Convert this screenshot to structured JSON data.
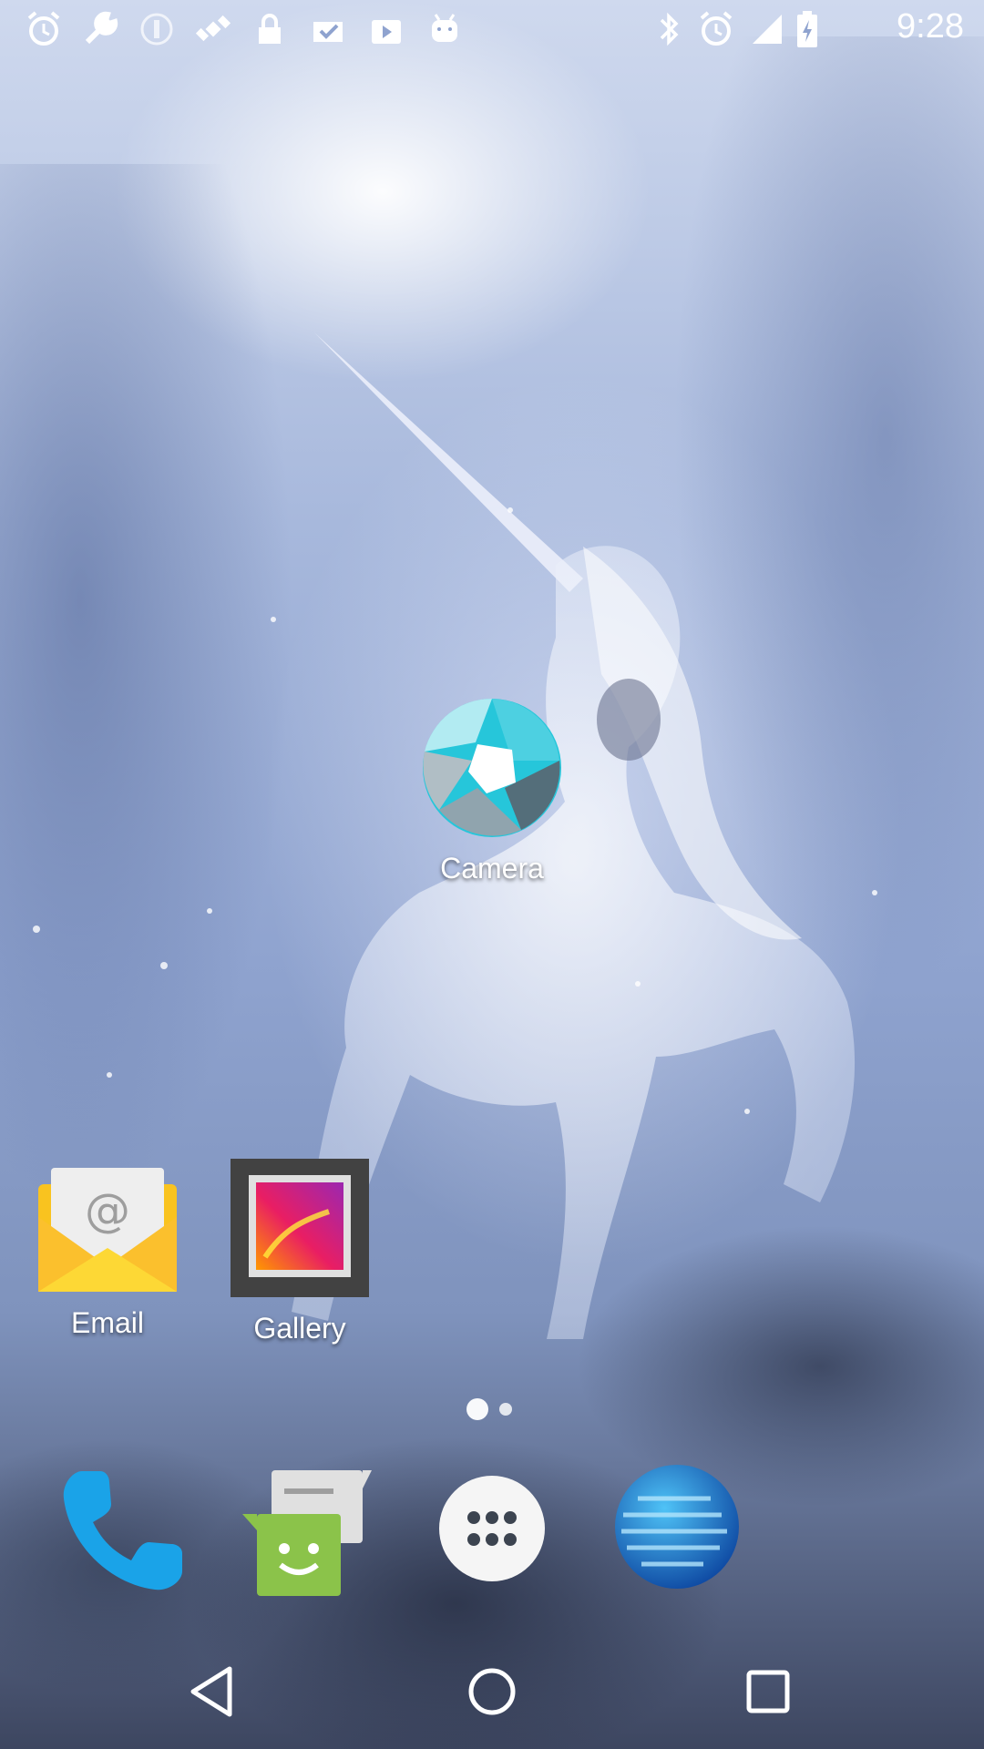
{
  "status_bar": {
    "time": "9:28",
    "left_icons": [
      "alarm-icon",
      "wrench-icon",
      "info-icon",
      "satellite-icon",
      "lock-icon",
      "clipboard-check-icon",
      "play-store-icon",
      "android-icon"
    ],
    "right_icons": [
      "bluetooth-icon",
      "alarm-icon",
      "signal-icon",
      "battery-icon"
    ]
  },
  "home": {
    "apps": [
      {
        "label": "Camera",
        "icon": "camera-shutter-icon"
      },
      {
        "label": "Email",
        "icon": "email-icon"
      },
      {
        "label": "Gallery",
        "icon": "gallery-icon"
      }
    ],
    "pages": {
      "count": 2,
      "current": 1
    }
  },
  "dock": [
    {
      "name": "phone",
      "icon": "phone-icon"
    },
    {
      "name": "messaging",
      "icon": "messaging-icon"
    },
    {
      "name": "app-drawer",
      "icon": "app-drawer-icon"
    },
    {
      "name": "browser",
      "icon": "globe-icon"
    }
  ],
  "nav": [
    "back-icon",
    "home-icon",
    "recents-icon"
  ],
  "colors": {
    "phone_blue": "#1aa3e8",
    "messaging_green": "#8bc34a",
    "email_yellow": "#f9c31f",
    "camera_cyan": "#26c6da"
  }
}
